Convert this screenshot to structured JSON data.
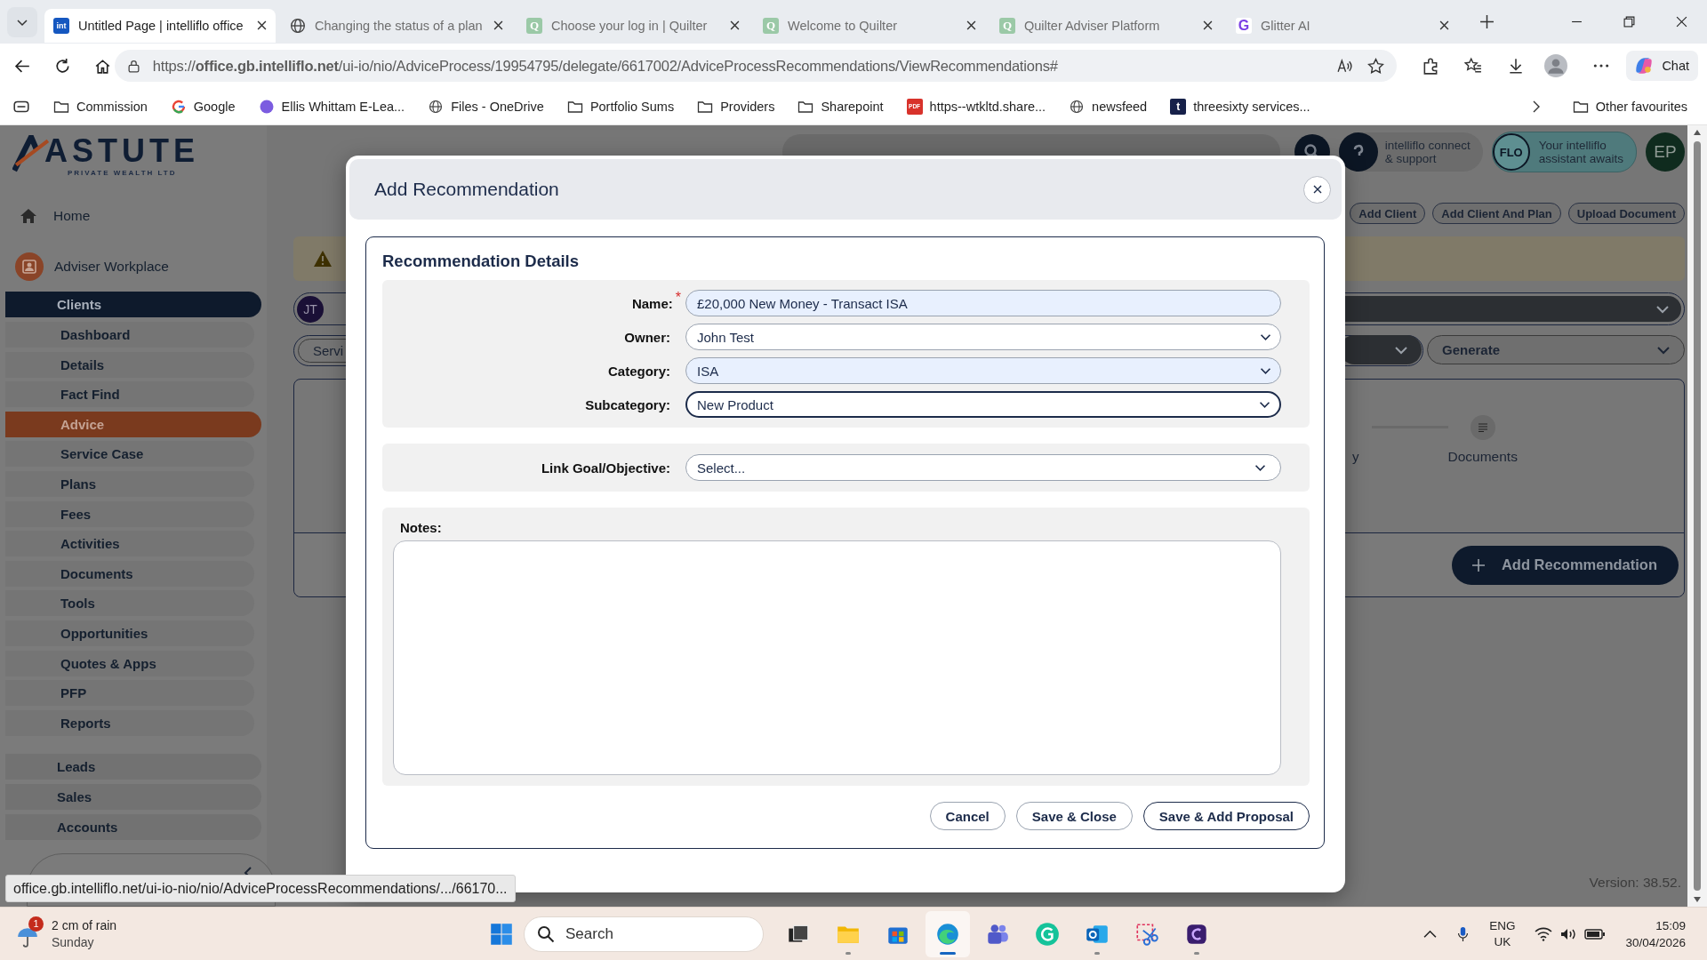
{
  "browser": {
    "tabs": [
      {
        "title": "Untitled Page | intelliflo office",
        "kind": "intelliflo",
        "icon_text": "int",
        "selected": true
      },
      {
        "title": "Changing the status of a plan",
        "kind": "globe",
        "selected": false
      },
      {
        "title": "Choose your log in | Quilter",
        "kind": "quilter",
        "icon_text": "Q",
        "selected": false
      },
      {
        "title": "Welcome to Quilter",
        "kind": "quilter",
        "icon_text": "Q",
        "selected": false
      },
      {
        "title": "Quilter Adviser Platform",
        "kind": "quilter",
        "icon_text": "Q",
        "selected": false
      },
      {
        "title": "Glitter AI",
        "kind": "glitter",
        "icon_text": "G",
        "selected": false
      }
    ],
    "url": "https://**office.gb.intelliflo.net**/ui-io/nio/AdviceProcess/19954795/delegate/6617002/AdviceProcessRecommendations/ViewRecommendations#",
    "chat_label": "Chat",
    "bookmarks": [
      {
        "label": "Commission",
        "kind": "folder"
      },
      {
        "label": "Google",
        "kind": "google"
      },
      {
        "label": "Ellis Whittam E-Lea...",
        "kind": "flexi"
      },
      {
        "label": "Files - OneDrive",
        "kind": "globe"
      },
      {
        "label": "Portfolio Sums",
        "kind": "folder"
      },
      {
        "label": "Providers",
        "kind": "folder"
      },
      {
        "label": "Sharepoint",
        "kind": "folder"
      },
      {
        "label": "https--wtkltd.share...",
        "kind": "pdf",
        "icon_text": "PDF"
      },
      {
        "label": "newsfeed",
        "kind": "globe"
      },
      {
        "label": "threesixty services...",
        "kind": "threesixty",
        "icon_text": "t"
      }
    ],
    "other_favourites": "Other favourites"
  },
  "sidebar": {
    "logo": {
      "name": "ASTUTE",
      "tagline": "PRIVATE WEALTH LTD"
    },
    "home": "Home",
    "workplace": "Adviser Workplace",
    "items": [
      {
        "label": "Clients",
        "selected": true,
        "children": [
          {
            "label": "Dashboard",
            "selected": false
          },
          {
            "label": "Details",
            "selected": false
          },
          {
            "label": "Fact Find",
            "selected": false
          },
          {
            "label": "Advice",
            "selected": true
          },
          {
            "label": "Service Case",
            "selected": false
          },
          {
            "label": "Plans",
            "selected": false
          },
          {
            "label": "Fees",
            "selected": false
          },
          {
            "label": "Activities",
            "selected": false
          },
          {
            "label": "Documents",
            "selected": false
          },
          {
            "label": "Tools",
            "selected": false
          },
          {
            "label": "Opportunities",
            "selected": false
          },
          {
            "label": "Quotes & Apps",
            "selected": false
          },
          {
            "label": "PFP",
            "selected": false
          },
          {
            "label": "Reports",
            "selected": false
          }
        ]
      },
      {
        "label": "Leads",
        "selected": false
      },
      {
        "label": "Sales",
        "selected": false
      },
      {
        "label": "Accounts",
        "selected": false
      }
    ]
  },
  "header": {
    "connect": "intelliflo connect\n& support",
    "flo_badge": "FLO",
    "flo_text": "Your intelliflo\nassistant awaits",
    "avatar": "EP"
  },
  "actions": [
    "Add Client",
    "Add Client And Plan",
    "Upload Document"
  ],
  "client_bar": {
    "avatar": "JT"
  },
  "toolbar": {
    "pill": "Servi",
    "generate": "Generate"
  },
  "stepper": {
    "cut_label": "y",
    "documents": "Documents"
  },
  "add_recommendation": "Add Recommendation",
  "version": "Version: 38.52.",
  "status_url": "office.gb.intelliflo.net/ui-io-nio/nio/AdviceProcessRecommendations/.../66170...",
  "modal": {
    "title": "Add Recommendation",
    "section_title": "Recommendation Details",
    "required_mark": "*",
    "fields": [
      {
        "label": "Name:",
        "kind": "text",
        "value": "£20,000 New Money - Transact ISA",
        "required": true,
        "autofilled": true,
        "focused": false
      },
      {
        "label": "Owner:",
        "kind": "select",
        "value": "John Test",
        "required": false,
        "autofilled": false,
        "focused": false
      },
      {
        "label": "Category:",
        "kind": "select",
        "value": "ISA",
        "required": false,
        "autofilled": true,
        "focused": false
      },
      {
        "label": "Subcategory:",
        "kind": "select",
        "value": "New Product",
        "required": false,
        "autofilled": false,
        "focused": true
      }
    ],
    "goal": {
      "label": "Link Goal/Objective:",
      "value": "Select..."
    },
    "notes_label": "Notes:",
    "buttons": [
      {
        "label": "Cancel",
        "kind": "plain"
      },
      {
        "label": "Save & Close",
        "kind": "plain"
      },
      {
        "label": "Save & Add Proposal",
        "kind": "primary"
      }
    ]
  },
  "taskbar": {
    "weather": {
      "badge": "1",
      "text": "2 cm of rain",
      "day": "Sunday"
    },
    "search": "Search",
    "apps": [
      {
        "kind": "taskview",
        "running": false,
        "selected": false
      },
      {
        "kind": "explorer",
        "running": true,
        "selected": false
      },
      {
        "kind": "store",
        "running": false,
        "selected": false
      },
      {
        "kind": "edge",
        "running": true,
        "selected": true
      },
      {
        "kind": "teams",
        "running": false,
        "selected": false
      },
      {
        "kind": "grammarly",
        "running": false,
        "selected": false
      },
      {
        "kind": "outlook",
        "running": true,
        "selected": false
      },
      {
        "kind": "snip",
        "running": false,
        "selected": false
      },
      {
        "kind": "purple",
        "running": true,
        "selected": false
      }
    ],
    "language": "ENG",
    "region": "UK",
    "time": "15:09",
    "date": "30/04/2026"
  }
}
